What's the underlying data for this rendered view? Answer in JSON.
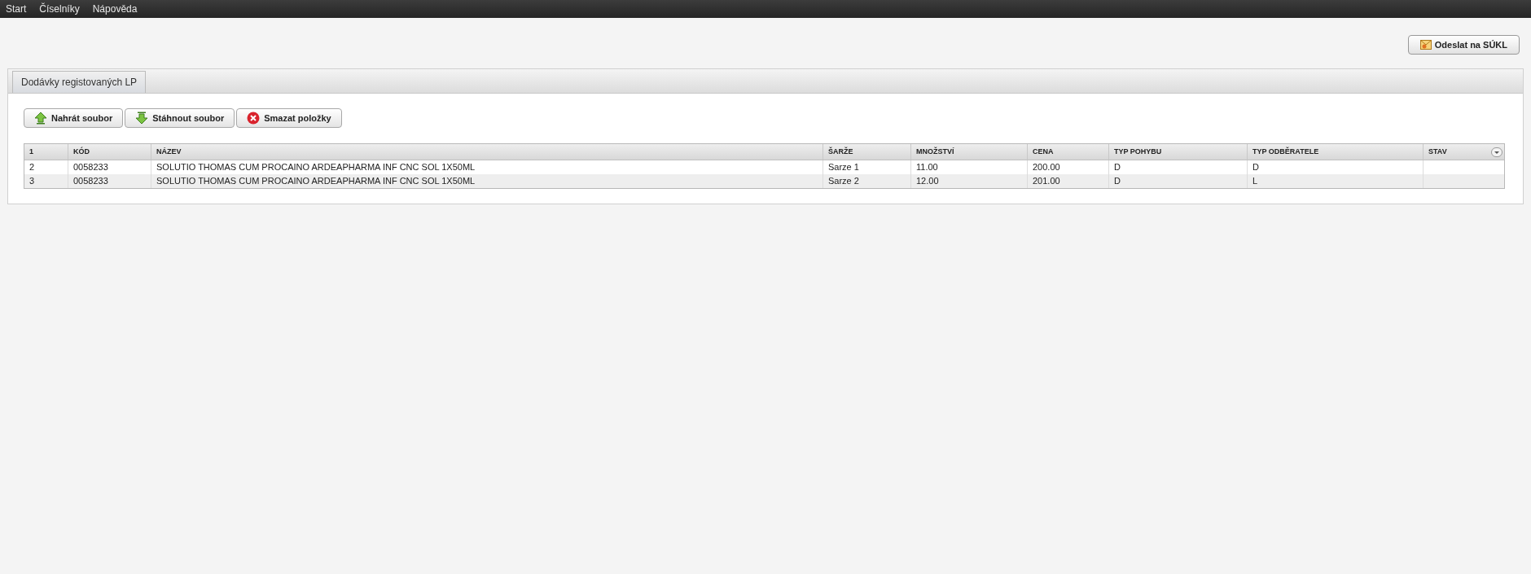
{
  "menu": [
    "Start",
    "Číselníky",
    "Nápověda"
  ],
  "send_button": "Odeslat na SÚKL",
  "tabs": [
    {
      "label": "Dodávky registovaných LP",
      "selected": true
    }
  ],
  "toolbar": [
    {
      "kind": "upload",
      "label": "Nahrát soubor"
    },
    {
      "kind": "download",
      "label": "Stáhnout soubor"
    },
    {
      "kind": "delete",
      "label": "Smazat položky"
    }
  ],
  "table": {
    "columns": [
      "1",
      "KÓD",
      "NÁZEV",
      "ŠARŽE",
      "MNOŽSTVÍ",
      "CENA",
      "TYP POHYBU",
      "TYP ODBĚRATELE",
      "STAV"
    ],
    "rows": [
      [
        "2",
        "0058233",
        "SOLUTIO THOMAS CUM PROCAINO ARDEAPHARMA INF CNC SOL 1X50ML",
        "Sarze 1",
        "11.00",
        "200.00",
        "D",
        "D",
        ""
      ],
      [
        "3",
        "0058233",
        "SOLUTIO THOMAS CUM PROCAINO ARDEAPHARMA INF CNC SOL 1X50ML",
        "Sarze 2",
        "12.00",
        "201.00",
        "D",
        "L",
        ""
      ]
    ]
  }
}
